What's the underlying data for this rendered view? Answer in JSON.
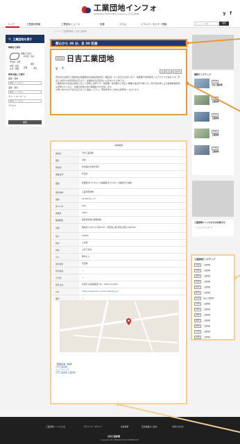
{
  "header": {
    "title": "工業団地インフォ",
    "subtitle": "INDUSTRIAL ESTATE INFO   Powered by 日刊工業新聞",
    "social": [
      "y",
      "f"
    ]
  },
  "nav": {
    "items": [
      "トップ",
      "工業団地情報",
      "工業団地ニュース",
      "特集",
      "コラム",
      "イベント・セミナー情報"
    ],
    "search_placeholder": "キーワード検索",
    "search_button": "検索"
  },
  "breadcrumb": "トップ > 工業団地情報 > 日吉工業団地",
  "sidebar_left": {
    "heading": "工業団地を探す",
    "region_label": "地域から探す",
    "region_note": "地図から探す",
    "map_pins": [
      "北海道・東北",
      "甲信越・北陸",
      "関東",
      "中国・四国",
      "九州・沖縄",
      "近畿",
      "東海"
    ],
    "condition_label": "条件を絞って探す",
    "rows": [
      "面積・価格",
      "業種・用途",
      "グリーンキーワード",
      "アクセス"
    ],
    "select_placeholder": "選択してください",
    "search_button": "検索"
  },
  "access_banner": "都心から 30 分、全 30 区画",
  "article": {
    "tag": "埼玉県",
    "title": "日吉工業団地",
    "social": [
      "y",
      "f"
    ],
    "chips": [
      "分譲",
      "賃貸",
      "産業用地"
    ],
    "paragraphs": [
      "埼玉県比企郡の工業団地は首都圏中央連絡自動車道（圏央道）から至近の位置にあり、首都圏や関東各地へのアクセスが良好です。周辺には豊かな自然環境が広がり、従業員の生活環境にも恵まれた立地です。",
      "工業団地内の区画は用途に応じて柔軟に選択でき、製造業・物流業など幅広い業種の進出が可能です。地元自治体による各種優遇制度も整備されており、企業の新規立地や事業拡大を支援します。",
      "お問い合わせは下記の窓口までご連絡ください。現地見学のご案内も随時承っております。"
    ]
  },
  "table": {
    "title": "基本情報",
    "rows": [
      {
        "label": "団地名",
        "value": "日吉工業団地"
      },
      {
        "label": "国名",
        "value": "日本"
      },
      {
        "label": "所在地",
        "value": "埼玉県比企郡吉見町"
      },
      {
        "label": "事業主体",
        "value": "埼玉県"
      },
      {
        "label": "面積",
        "value": "総面積 約 11.5ha / 分譲面積 約 8.2ha / 分譲状況 分譲中"
      },
      {
        "label": "用途地域",
        "value": "工業専用地域"
      },
      {
        "label": "価格",
        "value": "25,000 円 / m²"
      },
      {
        "label": "建ぺい率",
        "value": "60%"
      },
      {
        "label": "容積率",
        "value": "200%"
      },
      {
        "label": "優遇制度",
        "value": "固定資産税の課税免除"
      },
      {
        "label": "交通",
        "value": "圏央道 川島IC から約 5km / 東武東上線 東松山駅から約 8km"
      },
      {
        "label": "電力",
        "value": "6,600V"
      },
      {
        "label": "用水",
        "value": "上水道"
      },
      {
        "label": "排水",
        "value": "公共下水道"
      },
      {
        "label": "ガス",
        "value": "都市ガス"
      },
      {
        "label": "通信環境",
        "value": "光回線"
      },
      {
        "label": "周辺施設",
        "value": "―"
      },
      {
        "label": "その他",
        "value": "―"
      },
      {
        "label": "問合せ先",
        "value": "吉見町 産業振興課 TEL : 0493-54-0000"
      },
      {
        "label": "URL",
        "value": "https://www.town.yoshimi.saitama.jp/"
      },
      {
        "label": "備考",
        "value": "―"
      }
    ]
  },
  "related": {
    "heading": "【関連記事・情報】",
    "links": [
      "日刊工業新聞",
      "ニュースイッチ",
      "日刊工業新聞 工業団地"
    ]
  },
  "sidebar_right": {
    "pickup_title": "最新ピックアップ",
    "pickup_items": [
      {
        "tag": "埼玉県",
        "name": "日吉工業団地"
      },
      {
        "tag": "群馬県",
        "name": "工業団地"
      },
      {
        "tag": "栃木県",
        "name": "工業団地"
      },
      {
        "tag": "茨城県",
        "name": "工業団地"
      },
      {
        "tag": "千葉県",
        "name": "工業団地"
      }
    ],
    "info_title": "工業団地インフォからのお知らせ",
    "info_text": "・リニューアルしました",
    "pickup2_title": "工業団地ピックアップ",
    "pickup2_items": [
      {
        "tag": "北海道",
        "name": "工業団地"
      },
      {
        "tag": "宮城県",
        "name": "工業団地"
      },
      {
        "tag": "福島県",
        "name": "工業団地"
      },
      {
        "tag": "茨城県",
        "name": "工業団地"
      },
      {
        "tag": "栃木県",
        "name": "工業団地"
      },
      {
        "tag": "群馬県",
        "name": "工業団地"
      },
      {
        "tag": "埼玉県",
        "name": "日吉工業団地"
      },
      {
        "tag": "千葉県",
        "name": "工業団地"
      },
      {
        "tag": "新潟県",
        "name": "工業団地"
      },
      {
        "tag": "長野県",
        "name": "工業団地"
      },
      {
        "tag": "静岡県",
        "name": "工業団地"
      },
      {
        "tag": "愛知県",
        "name": "工業団地"
      },
      {
        "tag": "三重県",
        "name": "工業団地"
      },
      {
        "tag": "兵庫県",
        "name": "工業団地"
      }
    ]
  },
  "footer": {
    "links": [
      "工業団地インフォとは",
      "プライバシーポリシー",
      "免責事項",
      "広告掲載のご案内",
      "お問い合わせ"
    ],
    "logo": "日刊工業新聞",
    "copyright": "Copyright 2017 NIKKAN KOGYO SHIMBUN,LTD."
  },
  "colors": {
    "accent": "#c8161d",
    "navy": "#1d3a78",
    "callout_orange": "#e59a3a",
    "callout_light": "#f2cf95"
  }
}
